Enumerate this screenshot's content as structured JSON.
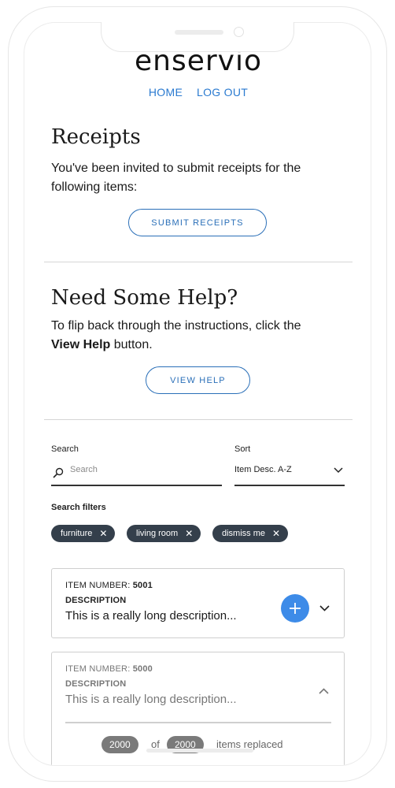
{
  "brand": {
    "logo_text": "enservio"
  },
  "nav": {
    "home": "HOME",
    "logout": "LOG OUT"
  },
  "receipts": {
    "title": "Receipts",
    "text_line1": "You've been invited to submit receipts for the",
    "text_line2": "following items:",
    "button": "SUBMIT RECEIPTS"
  },
  "help": {
    "title": "Need Some Help?",
    "text_line1": "To flip back through the instructions, click the",
    "text_bold": "View Help",
    "text_after": " button.",
    "button": "VIEW HELP"
  },
  "search": {
    "label": "Search",
    "placeholder": "Search"
  },
  "sort": {
    "label": "Sort",
    "value": "Item Desc. A-Z"
  },
  "filters": {
    "label": "Search filters",
    "chips": [
      {
        "label": "furniture"
      },
      {
        "label": "living room"
      },
      {
        "label": "dismiss me"
      }
    ]
  },
  "items": [
    {
      "number_label": "ITEM NUMBER:",
      "number": "5001",
      "desc_label": "DESCRIPTION",
      "desc": "This is a really long description..."
    },
    {
      "number_label": "ITEM NUMBER:",
      "number": "5000",
      "desc_label": "DESCRIPTION",
      "desc": "This is a really long description...",
      "replaced_count": "2000",
      "of_text": "of",
      "total_count": "2000",
      "replaced_text": "items replaced"
    }
  ],
  "colors": {
    "accent": "#2a7ad0",
    "chip_bg": "#343f4b",
    "fab": "#3d8be8",
    "pill": "#7a7a7a"
  }
}
